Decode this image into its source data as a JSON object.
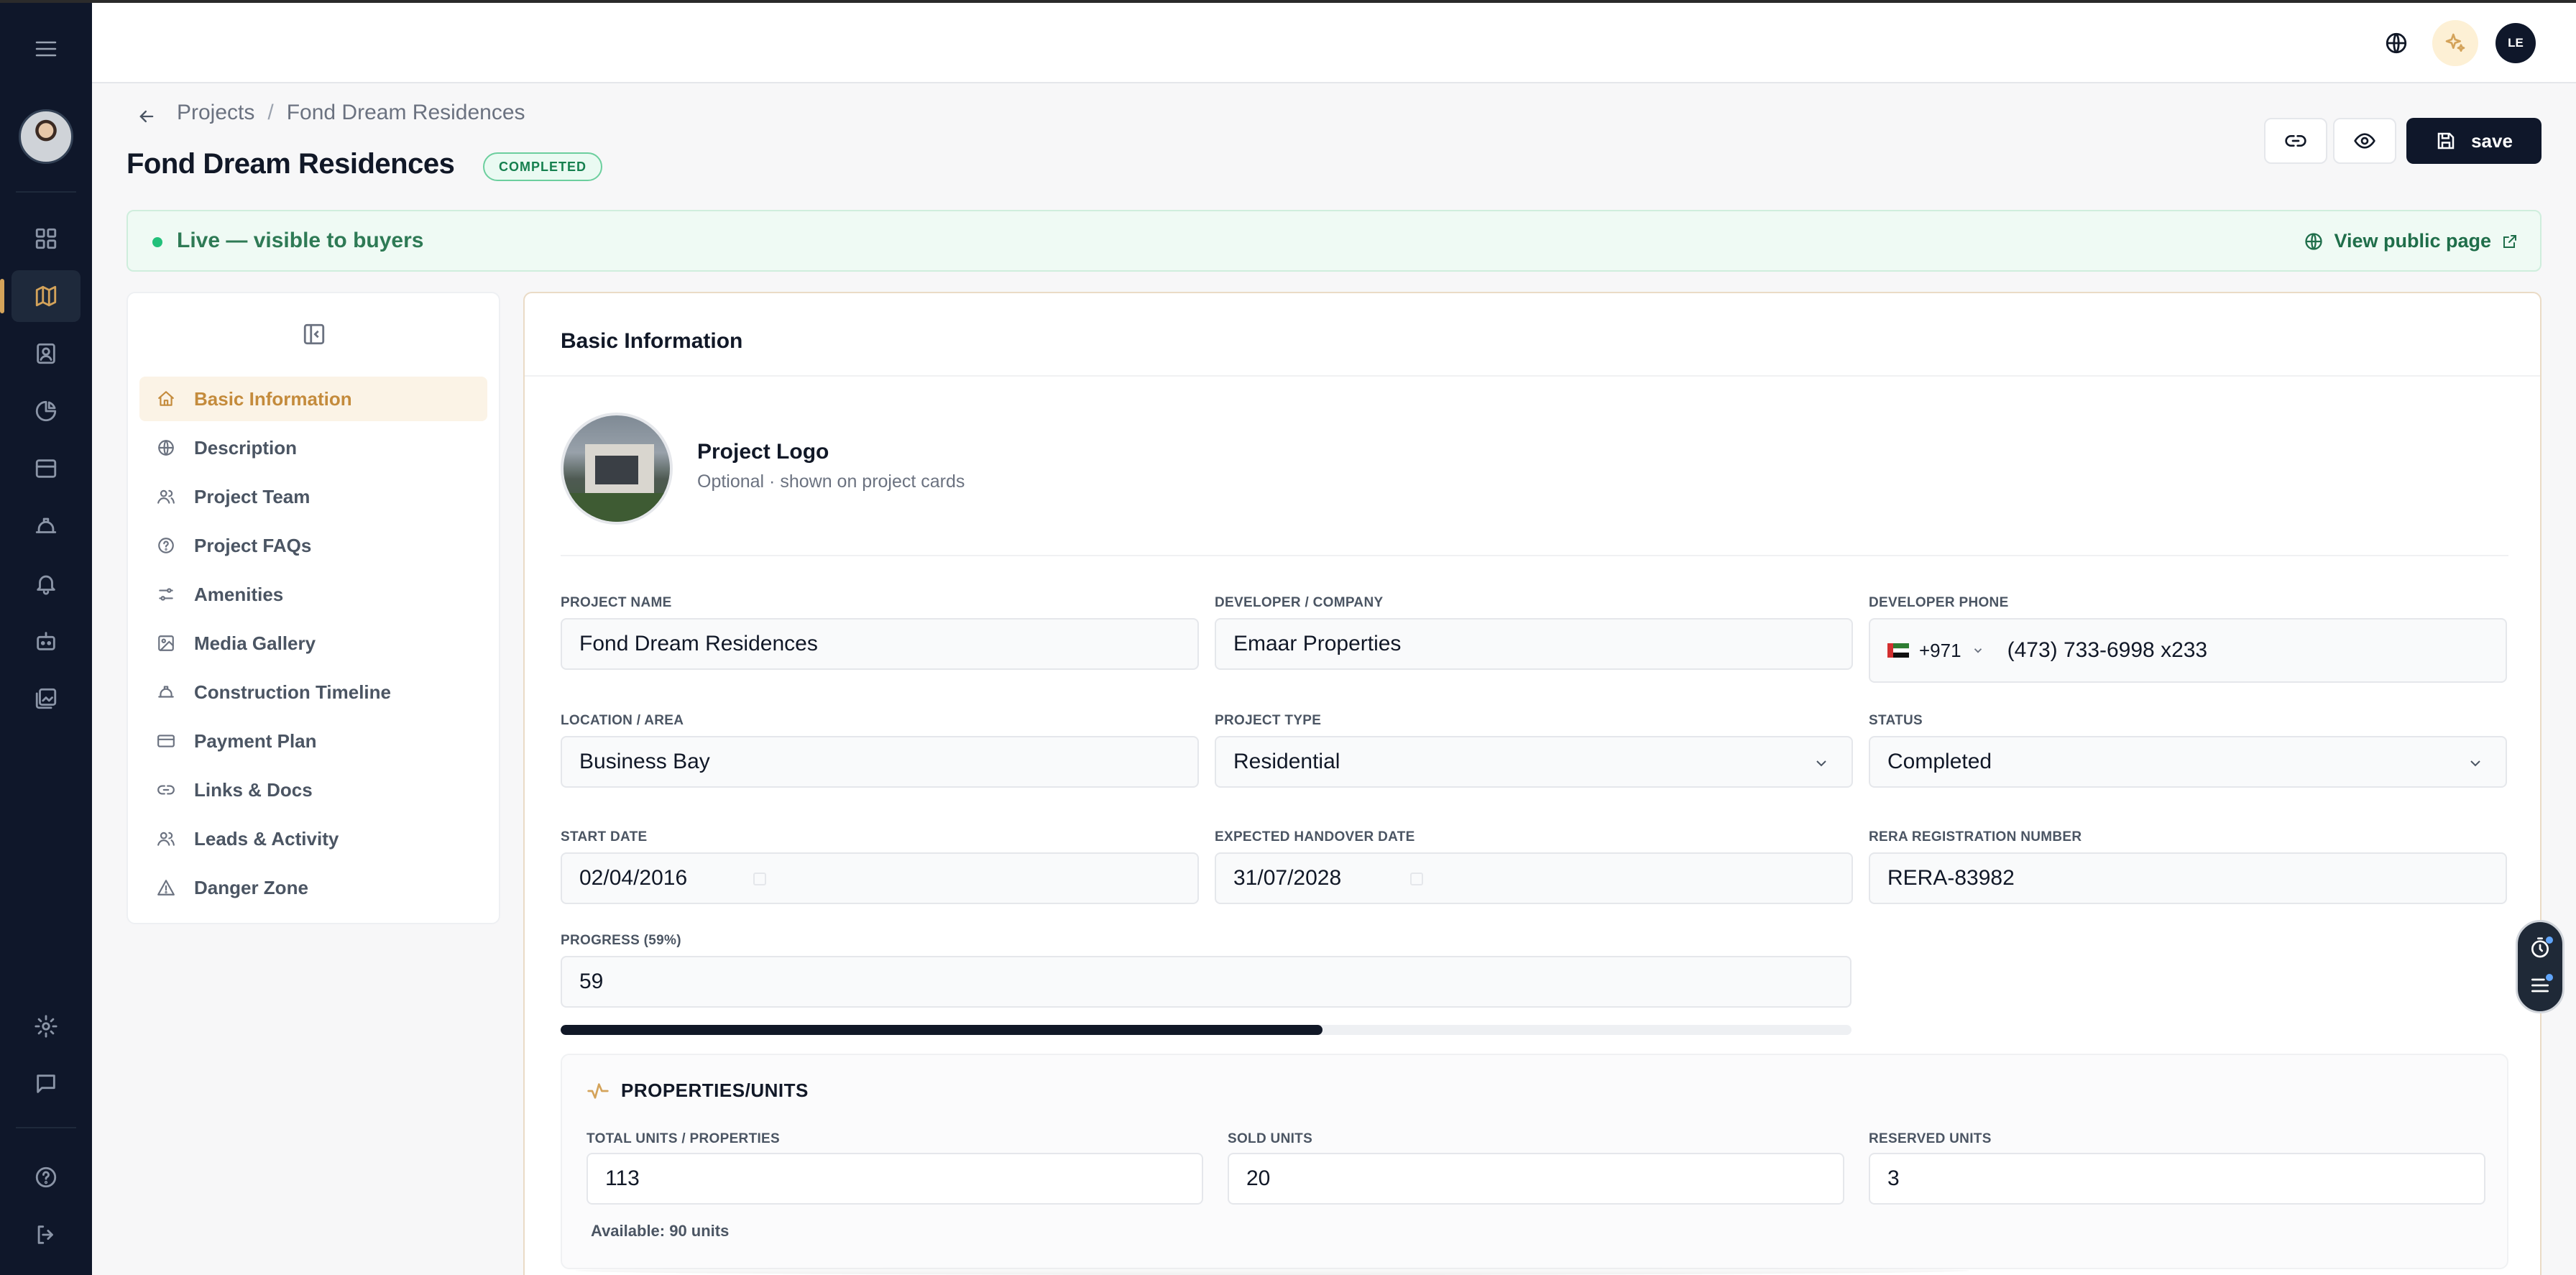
{
  "topbar": {
    "user_initials": "LE",
    "accent_color": "#d4a35a"
  },
  "breadcrumb": {
    "root": "Projects",
    "separator": "/",
    "current": "Fond Dream Residences"
  },
  "header": {
    "title": "Fond Dream Residences",
    "status_badge": "COMPLETED",
    "save_label": "save"
  },
  "banner": {
    "live_text": "Live — visible to buyers",
    "public_link": "View public page"
  },
  "nav": {
    "items": [
      {
        "label": "Basic Information",
        "icon": "home-icon"
      },
      {
        "label": "Description",
        "icon": "globe-icon"
      },
      {
        "label": "Project Team",
        "icon": "users-icon"
      },
      {
        "label": "Project FAQs",
        "icon": "help-circle-icon"
      },
      {
        "label": "Amenities",
        "icon": "sliders-icon"
      },
      {
        "label": "Media Gallery",
        "icon": "image-icon"
      },
      {
        "label": "Construction Timeline",
        "icon": "hard-hat-icon"
      },
      {
        "label": "Payment Plan",
        "icon": "credit-card-icon"
      },
      {
        "label": "Links & Docs",
        "icon": "link-icon"
      },
      {
        "label": "Leads & Activity",
        "icon": "users-icon"
      },
      {
        "label": "Danger Zone",
        "icon": "warning-icon"
      }
    ]
  },
  "form": {
    "card_title": "Basic Information",
    "logo": {
      "title": "Project Logo",
      "subtitle": "Optional · shown on project cards"
    },
    "project_name": {
      "label": "PROJECT NAME",
      "value": "Fond Dream Residences"
    },
    "developer": {
      "label": "DEVELOPER / COMPANY",
      "value": "Emaar Properties"
    },
    "developer_phone": {
      "label": "DEVELOPER PHONE",
      "country_code": "+971",
      "number": "(473) 733-6998 x233"
    },
    "location": {
      "label": "LOCATION / AREA",
      "value": "Business Bay"
    },
    "project_type": {
      "label": "PROJECT TYPE",
      "value": "Residential"
    },
    "status": {
      "label": "STATUS",
      "value": "Completed"
    },
    "start_date": {
      "label": "START DATE",
      "value": "02/04/2016"
    },
    "handover_date": {
      "label": "EXPECTED HANDOVER DATE",
      "value": "31/07/2028"
    },
    "rera": {
      "label": "RERA REGISTRATION NUMBER",
      "value": "RERA-83982"
    },
    "progress": {
      "label": "PROGRESS (59%)",
      "value": "59",
      "percent": 59
    }
  },
  "units": {
    "title": "PROPERTIES/UNITS",
    "total": {
      "label": "TOTAL UNITS / PROPERTIES",
      "value": "113"
    },
    "sold": {
      "label": "SOLD UNITS",
      "value": "20"
    },
    "reserved": {
      "label": "RESERVED UNITS",
      "value": "3"
    },
    "available_text": "Available: 90 units"
  }
}
